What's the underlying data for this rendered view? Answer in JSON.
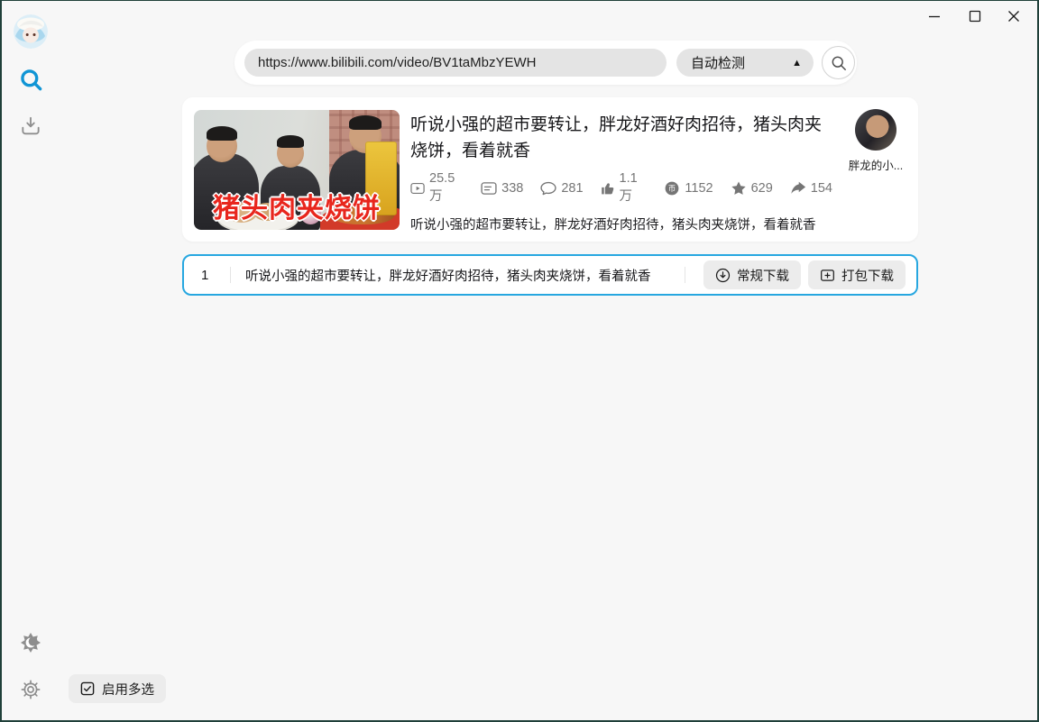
{
  "titlebar": {
    "icons": [
      "minimize-icon",
      "maximize-icon",
      "close-icon"
    ]
  },
  "sidebar": {
    "icons": [
      "app-avatar",
      "search-icon",
      "download-manager-icon",
      "theme-toggle-icon",
      "settings-gear-icon"
    ],
    "search_blue": "#1095d5",
    "icon_gray": "#8e8e8e"
  },
  "topbar": {
    "url_value": "https://www.bilibili.com/video/BV1taMbzYEWH",
    "detect_label": "自动检测",
    "detect_arrow": "▲",
    "search_icon": "magnifier"
  },
  "video_card": {
    "title": "听说小强的超市要转让，胖龙好酒好肉招待，猪头肉夹烧饼，看着就香",
    "description": "听说小强的超市要转让，胖龙好酒好肉招待，猪头肉夹烧饼，看着就香",
    "thumbnail_caption": "猪头肉夹烧饼",
    "uploader": "胖龙的小...",
    "stats": [
      {
        "icon": "play-count-icon",
        "value": "25.5万"
      },
      {
        "icon": "danmaku-icon",
        "value": "338"
      },
      {
        "icon": "comment-icon",
        "value": "281"
      },
      {
        "icon": "like-icon",
        "value": "1.1万"
      },
      {
        "icon": "coin-icon",
        "value": "1152"
      },
      {
        "icon": "favorite-icon",
        "value": "629"
      },
      {
        "icon": "share-icon",
        "value": "154"
      }
    ],
    "coin_glyph": "币"
  },
  "download_row": {
    "index": "1",
    "title": "听说小强的超市要转让，胖龙好酒好肉招待，猪头肉夹烧饼，看着就香",
    "regular_label": "常规下载",
    "pack_label": "打包下载"
  },
  "footer": {
    "multiselect_label": "启用多选"
  },
  "colors": {
    "accent_blue_border": "#27a7e0",
    "sidebar_search_blue": "#1095d5",
    "stat_gray": "#757575",
    "window_border": "#20403a",
    "thumbnail_caption_red": "#e8261d"
  }
}
